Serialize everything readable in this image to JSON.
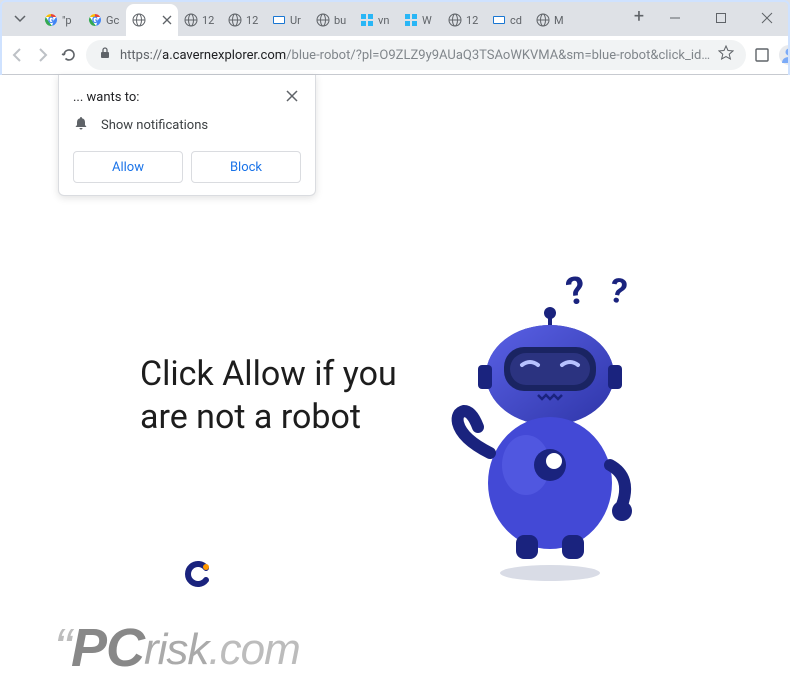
{
  "window": {
    "tabs": [
      {
        "label": "\"p",
        "favicon": "g-color"
      },
      {
        "label": "Gc",
        "favicon": "g-color"
      },
      {
        "label": "",
        "favicon": "globe",
        "active": true
      },
      {
        "label": "12",
        "favicon": "globe"
      },
      {
        "label": "12",
        "favicon": "globe"
      },
      {
        "label": "Ur",
        "favicon": "kb"
      },
      {
        "label": "bu",
        "favicon": "globe"
      },
      {
        "label": "vn",
        "favicon": "win-blue"
      },
      {
        "label": "W",
        "favicon": "win-blue"
      },
      {
        "label": "12",
        "favicon": "globe"
      },
      {
        "label": "cd",
        "favicon": "kb"
      },
      {
        "label": "M",
        "favicon": "globe"
      }
    ],
    "new_tab_label": "+"
  },
  "toolbar": {
    "url_protocol": "https://",
    "url_host": "a.cavernexplorer.com",
    "url_path": "/blue-robot/?pl=O9ZLZ9y9AUaQ3TSAoWKVMA&sm=blue-robot&click_id…"
  },
  "permission": {
    "title": "... wants to:",
    "item": "Show notifications",
    "allow": "Allow",
    "block": "Block"
  },
  "page": {
    "headline": "Click Allow if you are not a robot"
  },
  "watermark": {
    "pc": "PC",
    "risk": "risk",
    "com": ".com"
  }
}
